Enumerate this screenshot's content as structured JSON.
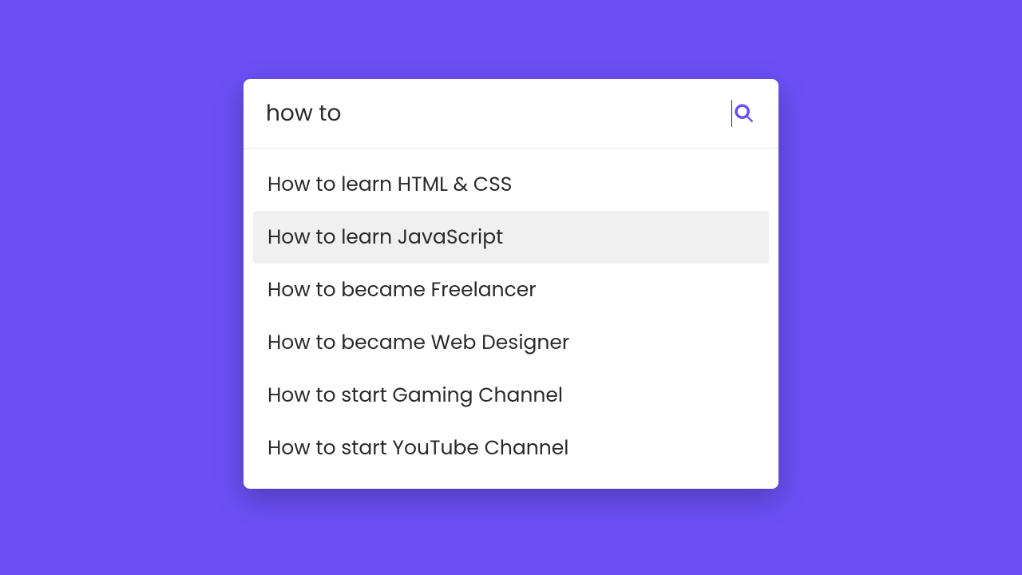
{
  "search": {
    "query": "how to ",
    "placeholder": ""
  },
  "suggestions": [
    {
      "text": "How to learn HTML & CSS",
      "highlighted": false
    },
    {
      "text": "How to learn JavaScript",
      "highlighted": true
    },
    {
      "text": "How to became Freelancer",
      "highlighted": false
    },
    {
      "text": "How to became Web Designer",
      "highlighted": false
    },
    {
      "text": "How to start Gaming Channel",
      "highlighted": false
    },
    {
      "text": "How to start YouTube Channel",
      "highlighted": false
    }
  ],
  "colors": {
    "background": "#6b4ff5",
    "accent": "#6b4ff5",
    "highlight": "#f0f0f0"
  }
}
